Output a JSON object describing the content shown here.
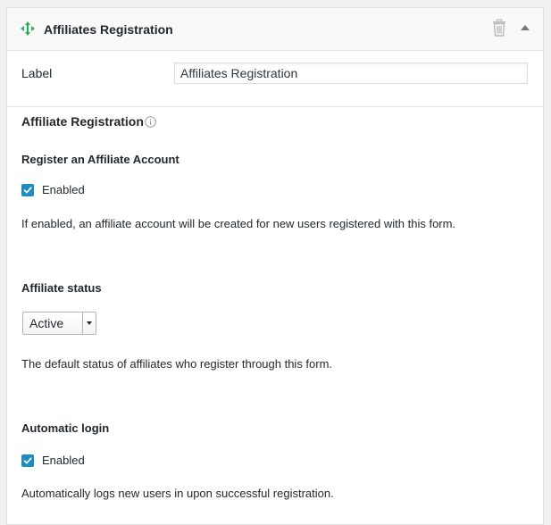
{
  "header": {
    "title": "Affiliates Registration"
  },
  "label_row": {
    "label": "Label",
    "value": "Affiliates Registration"
  },
  "section": {
    "title": "Affiliate Registration"
  },
  "register_account": {
    "heading": "Register an Affiliate Account",
    "checkbox_label": "Enabled",
    "checked": true,
    "description": "If enabled, an affiliate account will be created for new users registered with this form."
  },
  "affiliate_status": {
    "heading": "Affiliate status",
    "selected": "Active",
    "description": "The default status of affiliates who register through this form."
  },
  "automatic_login": {
    "heading": "Automatic login",
    "checkbox_label": "Enabled",
    "checked": true,
    "description": "Automatically logs new users in upon successful registration."
  },
  "colors": {
    "accent": "#1e8cbe",
    "block_icon": "#2aae5e"
  }
}
